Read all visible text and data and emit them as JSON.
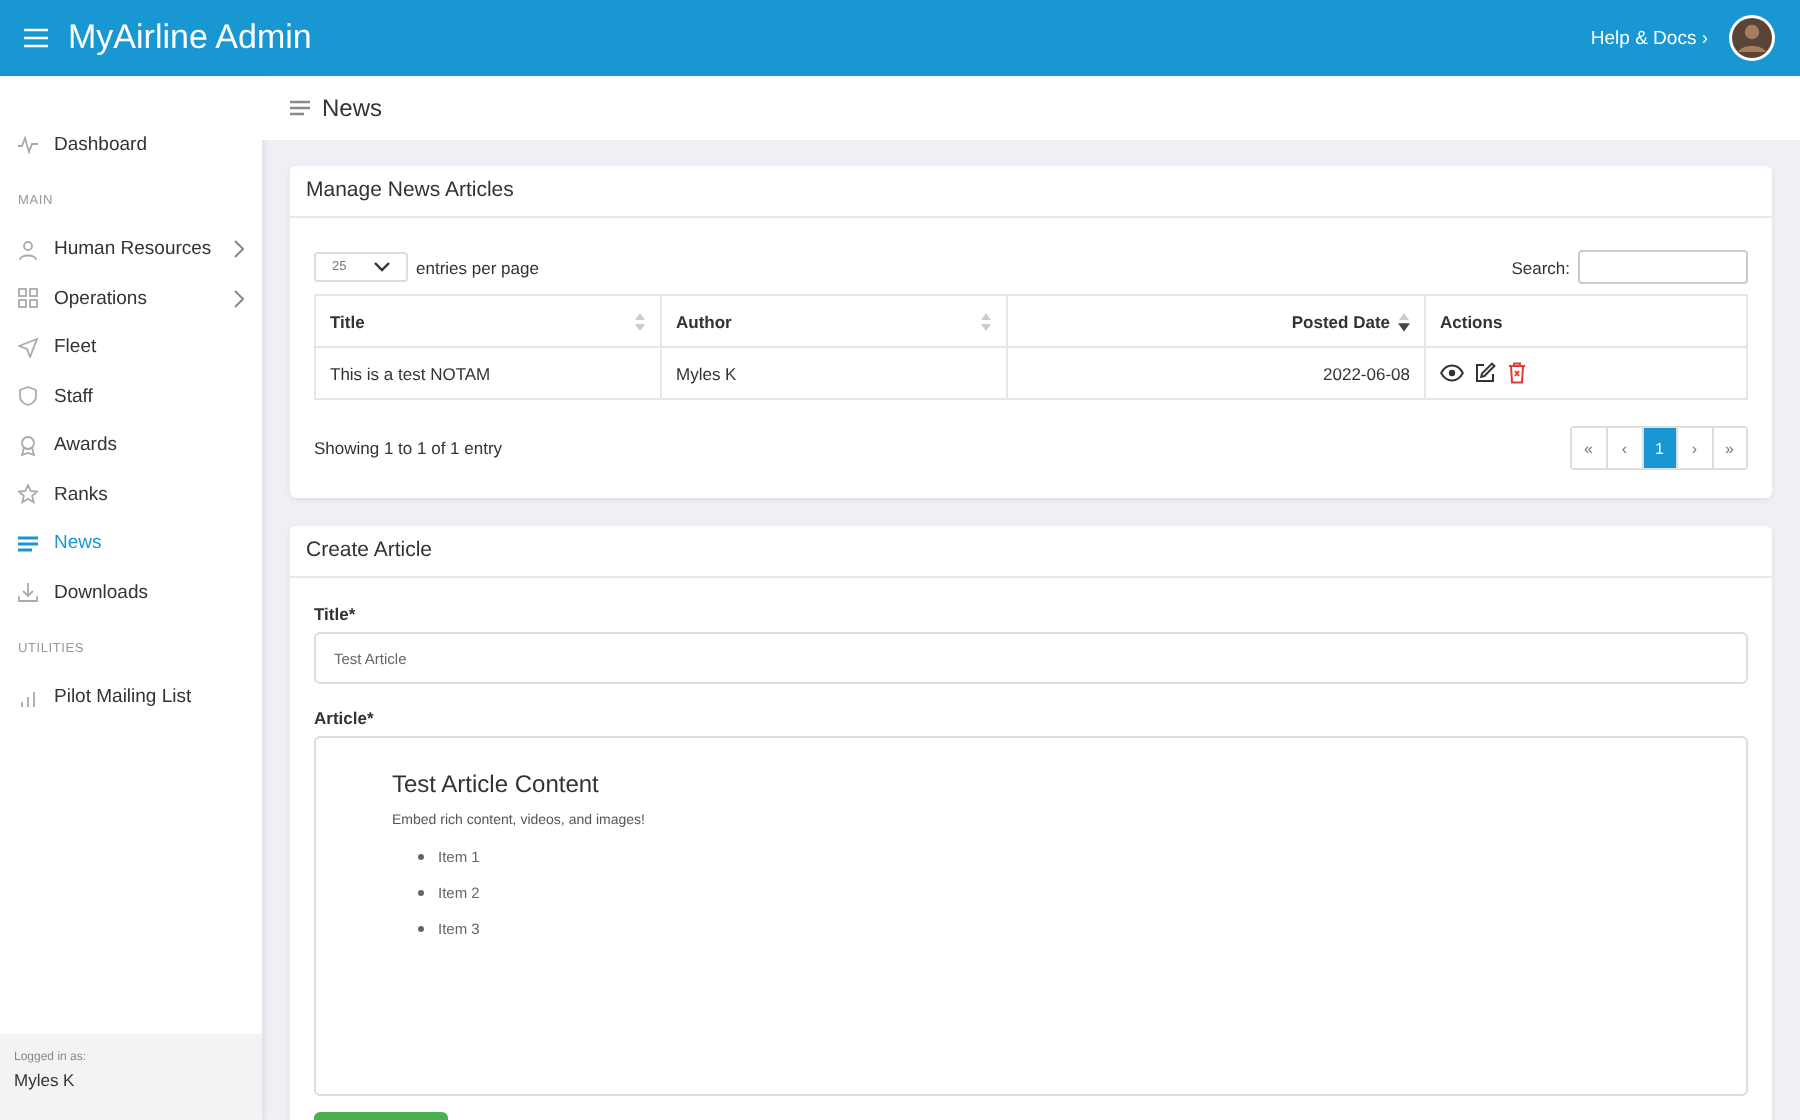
{
  "header": {
    "title": "MyAirline Admin",
    "help_link": "Help & Docs ›"
  },
  "sidebar": {
    "items": [
      {
        "kind": "item",
        "label": "Dashboard",
        "selected": false,
        "has_children": false
      },
      {
        "kind": "section",
        "label": "MAIN"
      },
      {
        "kind": "item",
        "label": "Human Resources",
        "selected": false,
        "has_children": true
      },
      {
        "kind": "item",
        "label": "Operations",
        "selected": false,
        "has_children": true
      },
      {
        "kind": "item",
        "label": "Fleet",
        "selected": false,
        "has_children": false
      },
      {
        "kind": "item",
        "label": "Staff",
        "selected": false,
        "has_children": false
      },
      {
        "kind": "item",
        "label": "Awards",
        "selected": false,
        "has_children": false
      },
      {
        "kind": "item",
        "label": "Ranks",
        "selected": false,
        "has_children": false
      },
      {
        "kind": "item",
        "label": "News",
        "selected": true,
        "has_children": false
      },
      {
        "kind": "item",
        "label": "Downloads",
        "selected": false,
        "has_children": false
      },
      {
        "kind": "section",
        "label": "UTILITIES"
      },
      {
        "kind": "item",
        "label": "Pilot Mailing List",
        "selected": false,
        "has_children": false
      }
    ],
    "footer": {
      "caption": "Logged in as:",
      "user": "Myles K"
    }
  },
  "page_title": "News",
  "manage_card": {
    "title": "Manage News Articles",
    "page_size": "25",
    "page_size_label": "entries per page",
    "search_label": "Search:",
    "table": {
      "columns": [
        {
          "label": "Title",
          "sortable": true,
          "sorted": false
        },
        {
          "label": "Author",
          "sortable": true,
          "sorted": false
        },
        {
          "label": "Posted Date",
          "sortable": true,
          "sorted": true
        },
        {
          "label": "Actions"
        }
      ],
      "rows": [
        {
          "cells": [
            "This is a test NOTAM",
            "Myles K",
            "2022-06-08"
          ]
        }
      ]
    },
    "info": "Showing 1 to 1 of 1 entry",
    "pagination": [
      {
        "label": "«",
        "selected": false
      },
      {
        "label": "‹",
        "selected": false
      },
      {
        "label": "1",
        "selected": true
      },
      {
        "label": "›",
        "selected": false
      },
      {
        "label": "»",
        "selected": false
      }
    ]
  },
  "create_card": {
    "title": "Create Article",
    "title_label": "Title*",
    "title_placeholder": "Test Article",
    "article_label": "Article*",
    "article": {
      "heading": "Test Article Content",
      "paragraph": "Embed rich content, videos, and images!",
      "list": [
        "Item 1",
        "Item 2",
        "Item 3"
      ]
    }
  }
}
